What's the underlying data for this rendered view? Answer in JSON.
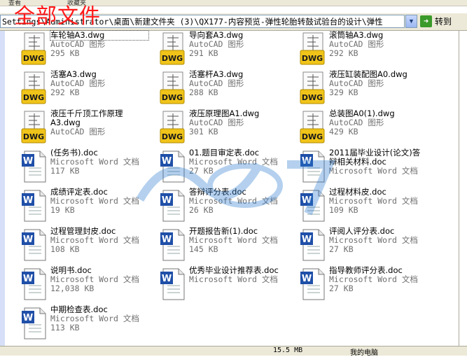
{
  "overlay_title": "全部文件",
  "menu": {
    "view": "查看",
    "fav": "收藏夹"
  },
  "address": {
    "path": "Settings\\Administrator\\桌面\\新建文件夹 (3)\\QX177-内容预览-弹性轮胎转鼓试验台的设计\\弹性",
    "go_label": "转到"
  },
  "files": [
    {
      "name": "车轮轴A3.dwg",
      "type": "AutoCAD 图形",
      "size": "295 KB",
      "icon": "dwg-icon"
    },
    {
      "name": "导向套A3.dwg",
      "type": "AutoCAD 图形",
      "size": "291 KB",
      "icon": "dwg-icon"
    },
    {
      "name": "滚筒轴A3.dwg",
      "type": "AutoCAD 图形",
      "size": "292 KB",
      "icon": "dwg-icon"
    },
    {
      "name": "活塞A3.dwg",
      "type": "AutoCAD 图形",
      "size": "292 KB",
      "icon": "dwg-icon"
    },
    {
      "name": "活塞杆A3.dwg",
      "type": "AutoCAD 图形",
      "size": "288 KB",
      "icon": "dwg-icon"
    },
    {
      "name": "液压缸装配图A0.dwg",
      "type": "AutoCAD 图形",
      "size": "329 KB",
      "icon": "dwg-icon"
    },
    {
      "name": "液压千斤顶工作原理A3.dwg",
      "type": "AutoCAD 图形",
      "size": "",
      "icon": "dwg-icon"
    },
    {
      "name": "液压原理图A1.dwg",
      "type": "AutoCAD 图形",
      "size": "301 KB",
      "icon": "dwg-icon"
    },
    {
      "name": "总装图A0(1).dwg",
      "type": "AutoCAD 图形",
      "size": "429 KB",
      "icon": "dwg-icon"
    },
    {
      "name": "(任务书).doc",
      "type": "Microsoft Word 文档",
      "size": "117 KB",
      "icon": "word-icon"
    },
    {
      "name": "01.题目审定表.doc",
      "type": "Microsoft Word 文档",
      "size": "27 KB",
      "icon": "word-icon"
    },
    {
      "name": "2011届毕业设计(论文)答辩相关材料.doc",
      "type": "Microsoft Word 文档",
      "size": "",
      "icon": "word-icon"
    },
    {
      "name": "成绩评定表.doc",
      "type": "Microsoft Word 文档",
      "size": "19 KB",
      "icon": "word-icon"
    },
    {
      "name": "答辩评分表.doc",
      "type": "Microsoft Word 文档",
      "size": "26 KB",
      "icon": "word-icon"
    },
    {
      "name": "过程材料皮.doc",
      "type": "Microsoft Word 文档",
      "size": "109 KB",
      "icon": "word-icon"
    },
    {
      "name": "过程管理封皮.doc",
      "type": "Microsoft Word 文档",
      "size": "108 KB",
      "icon": "word-icon"
    },
    {
      "name": "开题报告新(1).doc",
      "type": "Microsoft Word 文档",
      "size": "145 KB",
      "icon": "word-icon"
    },
    {
      "name": "评阅人评分表.doc",
      "type": "Microsoft Word 文档",
      "size": "27 KB",
      "icon": "word-icon"
    },
    {
      "name": "说明书.doc",
      "type": "Microsoft Word 文档",
      "size": "12,038 KB",
      "icon": "word-icon"
    },
    {
      "name": "优秀毕业设计推荐表.doc",
      "type": "Microsoft Word 文档",
      "size": "",
      "icon": "word-icon"
    },
    {
      "name": "指导教师评分表.doc",
      "type": "Microsoft Word 文档",
      "size": "27 KB",
      "icon": "word-icon"
    },
    {
      "name": "中期检查表.doc",
      "type": "Microsoft Word 文档",
      "size": "113 KB",
      "icon": "word-icon"
    }
  ],
  "status": {
    "size": "15.5 MB",
    "location": "我的电脑"
  },
  "colors": {
    "dwg_yellow": "#f0c419",
    "word_blue": "#1f4fa8",
    "title_red": "#ff1a1a"
  }
}
